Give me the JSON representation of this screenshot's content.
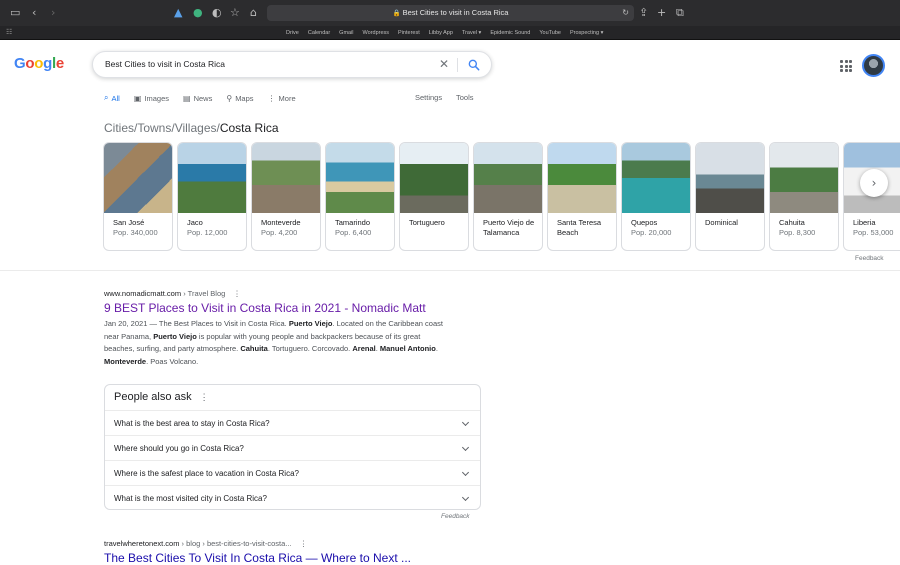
{
  "browser": {
    "url_text": "Best Cities to visit in Costa Rica",
    "bookmarks": [
      "Drive",
      "Calendar",
      "Gmail",
      "Wordpress",
      "Pinterest",
      "Libby App",
      "Travel ▾",
      "Epidemic Sound",
      "YouTube",
      "Prospecting ▾"
    ]
  },
  "search": {
    "query": "Best Cities to visit in Costa Rica",
    "tabs": [
      {
        "label": "All",
        "icon": "search-icon"
      },
      {
        "label": "Images",
        "icon": "image-icon"
      },
      {
        "label": "News",
        "icon": "news-icon"
      },
      {
        "label": "Maps",
        "icon": "map-pin-icon"
      },
      {
        "label": "More",
        "icon": "more-vert-icon"
      }
    ],
    "settings_label": "Settings",
    "tools_label": "Tools"
  },
  "carousel": {
    "breadcrumb_prefix": "Cities/Towns/Villages",
    "breadcrumb_sep": "/",
    "breadcrumb_current": "Costa Rica",
    "cards": [
      {
        "name": "San José",
        "pop": "Pop. 340,000"
      },
      {
        "name": "Jaco",
        "pop": "Pop. 12,000"
      },
      {
        "name": "Monteverde",
        "pop": "Pop. 4,200"
      },
      {
        "name": "Tamarindo",
        "pop": "Pop. 6,400"
      },
      {
        "name": "Tortuguero",
        "pop": ""
      },
      {
        "name": "Puerto Viejo de Talamanca",
        "pop": ""
      },
      {
        "name": "Santa Teresa Beach",
        "pop": ""
      },
      {
        "name": "Quepos",
        "pop": "Pop. 20,000"
      },
      {
        "name": "Dominical",
        "pop": ""
      },
      {
        "name": "Cahuita",
        "pop": "Pop. 8,300"
      },
      {
        "name": "Liberia",
        "pop": "Pop. 53,000"
      }
    ],
    "feedback": "Feedback"
  },
  "result1": {
    "domain": "www.nomadicmatt.com",
    "path": " › Travel Blog",
    "title": "9 BEST Places to Visit in Costa Rica in 2021 - Nomadic Matt",
    "date": "Jan 20, 2021",
    "s1": " — The Best Places to Visit in Costa Rica. ",
    "b1": "Puerto Viejo",
    "s2": ". Located on the Caribbean coast near Panama, ",
    "b2": "Puerto Viejo",
    "s3": " is popular with young people and backpackers because of its great beaches, surfing, and party atmosphere. ",
    "b3": "Cahuita",
    "s4": ". Tortuguero. Corcovado. ",
    "b4": "Arenal",
    "s5": ". ",
    "b5": "Manuel Antonio",
    "s6": ". ",
    "b6": "Monteverde",
    "s7": ". Poas Volcano."
  },
  "paa": {
    "heading": "People also ask",
    "questions": [
      "What is the best area to stay in Costa Rica?",
      "Where should you go in Costa Rica?",
      "Where is the safest place to vacation in Costa Rica?",
      "What is the most visited city in Costa Rica?"
    ],
    "feedback": "Feedback"
  },
  "result2": {
    "domain": "travelwheretonext.com",
    "path": " › blog › best-cities-to-visit-costa...",
    "title": "The Best Cities To Visit In Costa Rica — Where to Next ..."
  },
  "colors": {
    "link": "#1a0dab",
    "visited": "#681da8",
    "accent": "#1a73e8"
  }
}
